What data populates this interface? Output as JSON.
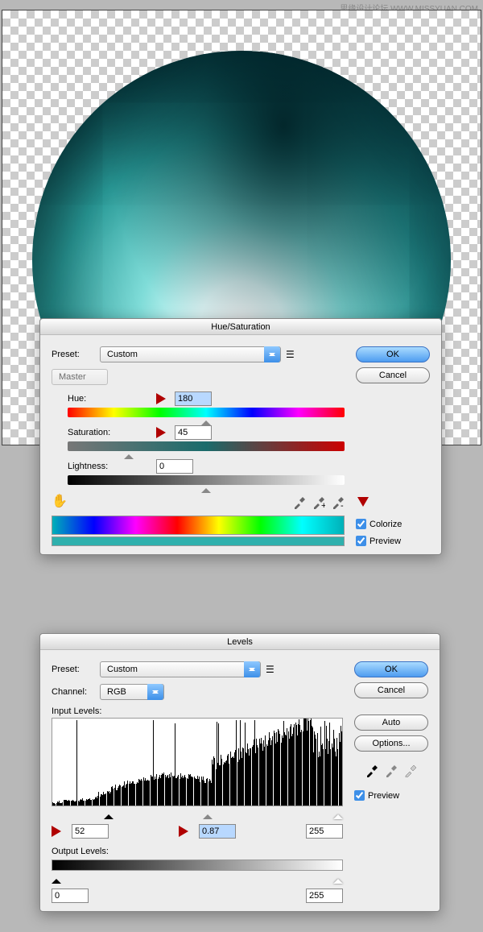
{
  "watermark": "思缘设计论坛 WWW.MISSYUAN.COM",
  "hue_dialog": {
    "title": "Hue/Saturation",
    "preset_label": "Preset:",
    "preset_value": "Custom",
    "edit_label": "Master",
    "hue": {
      "label": "Hue:",
      "value": "180"
    },
    "saturation": {
      "label": "Saturation:",
      "value": "45"
    },
    "lightness": {
      "label": "Lightness:",
      "value": "0"
    },
    "ok": "OK",
    "cancel": "Cancel",
    "colorize": "Colorize",
    "preview": "Preview"
  },
  "levels_dialog": {
    "title": "Levels",
    "preset_label": "Preset:",
    "preset_value": "Custom",
    "channel_label": "Channel:",
    "channel_value": "RGB",
    "input_label": "Input Levels:",
    "shadows": "52",
    "midtones": "0.87",
    "highlights": "255",
    "output_label": "Output Levels:",
    "out_low": "0",
    "out_high": "255",
    "ok": "OK",
    "cancel": "Cancel",
    "auto": "Auto",
    "options": "Options...",
    "preview": "Preview"
  }
}
